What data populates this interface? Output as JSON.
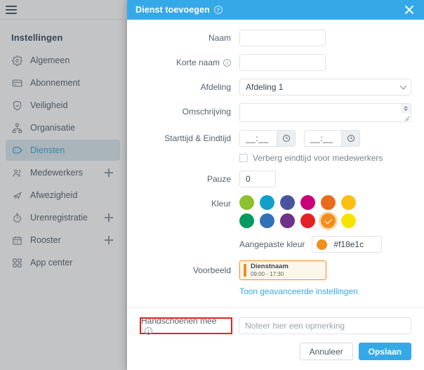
{
  "sidebar": {
    "menu_icon": "hamburger-icon",
    "title": "Instellingen",
    "items": [
      {
        "label": "Algemeen",
        "icon": "gear-icon",
        "active": false,
        "plus": false
      },
      {
        "label": "Abonnement",
        "icon": "card-icon",
        "active": false,
        "plus": false
      },
      {
        "label": "Veiligheid",
        "icon": "shield-icon",
        "active": false,
        "plus": false
      },
      {
        "label": "Organisatie",
        "icon": "org-chart-icon",
        "active": false,
        "plus": false
      },
      {
        "label": "Diensten",
        "icon": "tag-icon",
        "active": true,
        "plus": false
      },
      {
        "label": "Medewerkers",
        "icon": "users-icon",
        "active": false,
        "plus": true
      },
      {
        "label": "Afwezigheid",
        "icon": "plane-icon",
        "active": false,
        "plus": false
      },
      {
        "label": "Urenregistratie",
        "icon": "stopwatch-icon",
        "active": false,
        "plus": true
      },
      {
        "label": "Rooster",
        "icon": "calendar-icon",
        "active": false,
        "plus": true
      },
      {
        "label": "App center",
        "icon": "grid-icon",
        "active": false,
        "plus": false
      }
    ]
  },
  "modal": {
    "title": "Dienst toevoegen",
    "title_info_icon": "info-icon",
    "close_icon": "close-icon",
    "accent_color": "#35a8e8",
    "fields": {
      "naam": {
        "label": "Naam",
        "value": "",
        "placeholder": ""
      },
      "korte_naam": {
        "label": "Korte naam",
        "value": "",
        "placeholder": "",
        "info_icon": "info-icon"
      },
      "afdeling": {
        "label": "Afdeling",
        "value": "Afdeling 1",
        "options": [
          "Afdeling 1"
        ],
        "chevron_icon": "chevron-down-icon"
      },
      "omschrijving": {
        "label": "Omschrijving",
        "value": "",
        "placeholder": "",
        "spinner_icon": "spinner-icon",
        "resize_icon": "resize-grip-icon"
      },
      "tijd": {
        "label": "Starttijd & Eindtijd",
        "start_value": "__:__",
        "end_value": "__:__",
        "clock_icon": "clock-icon"
      },
      "verberg_eindtijd": {
        "label": "Verberg eindtijd voor medewerkers",
        "checked": false
      },
      "pauze": {
        "label": "Pauze",
        "value": "0"
      },
      "kleur": {
        "label": "Kleur"
      },
      "aangepaste_kleur": {
        "label": "Aangepaste kleur",
        "value": "#f18e1c",
        "dot_color": "#f18e1c"
      },
      "voorbeeld": {
        "label": "Voorbeeld",
        "name": "Dienstnaam",
        "time": "09:00 - 17:30",
        "border_color": "#f18e1c",
        "bg_color": "#fdf6ec"
      },
      "advanced_link": "Toon geavanceerde instellingen",
      "handschoenen": {
        "label": "Handschoenen mee",
        "info_icon": "info-icon",
        "placeholder": "Noteer hier een opmerking",
        "value": "",
        "highlight_color": "#e62020"
      }
    },
    "colors": {
      "row1": [
        "#8cc22e",
        "#12a0c8",
        "#4a549c",
        "#c9007a",
        "#ea6a1e",
        "#fcc013"
      ],
      "row2": [
        "#049b63",
        "#3171b7",
        "#6e3289",
        "#e32227",
        "#f18e1c",
        "#f5e400"
      ],
      "selected_index": 10,
      "check_icon": "check-icon"
    },
    "footer": {
      "cancel_label": "Annuleer",
      "save_label": "Opslaan"
    }
  }
}
